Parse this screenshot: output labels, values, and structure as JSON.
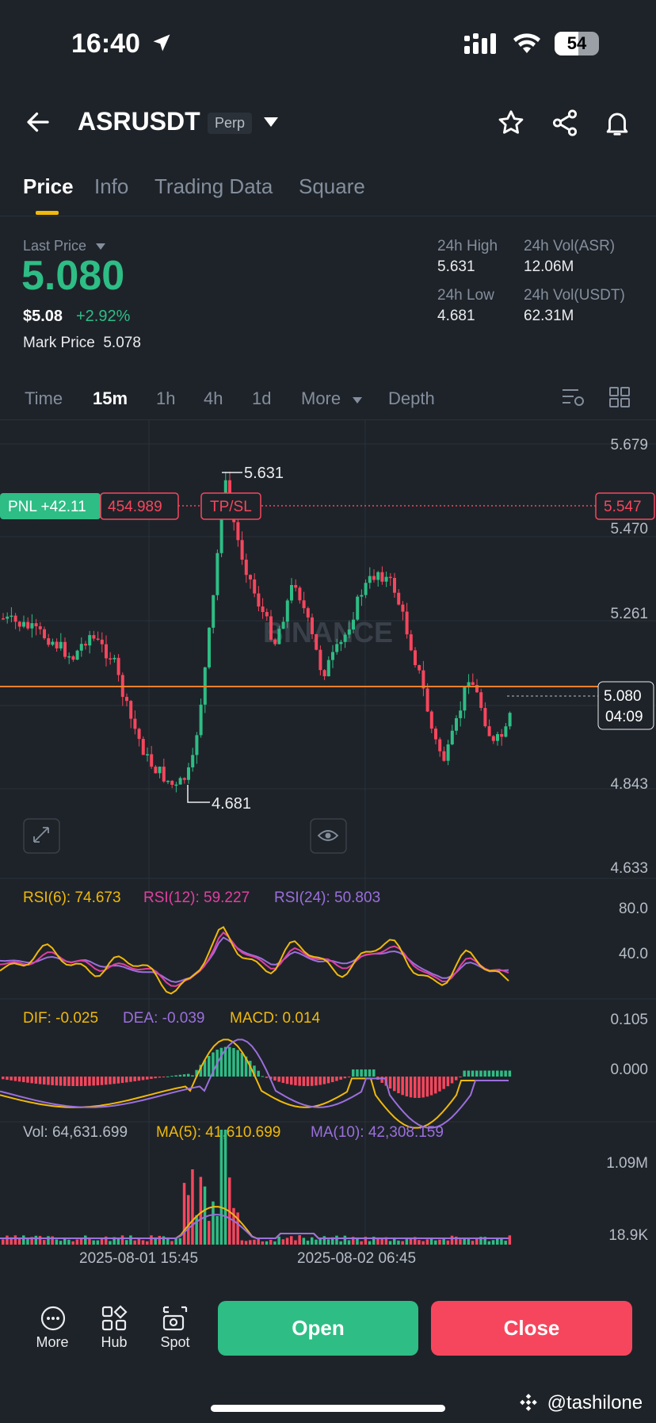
{
  "status": {
    "time": "16:40",
    "battery": "54"
  },
  "header": {
    "symbol": "ASRUSDT",
    "badge": "Perp"
  },
  "tabs": [
    "Price",
    "Info",
    "Trading Data",
    "Square"
  ],
  "price": {
    "last_label": "Last Price",
    "last": "5.080",
    "usd": "$5.08",
    "change": "+2.92%",
    "mark_label": "Mark Price",
    "mark": "5.078"
  },
  "stats": {
    "high_label": "24h High",
    "high": "5.631",
    "low_label": "24h Low",
    "low": "4.681",
    "vol_asr_label": "24h Vol(ASR)",
    "vol_asr": "12.06M",
    "vol_usdt_label": "24h Vol(USDT)",
    "vol_usdt": "62.31M"
  },
  "intervals": {
    "time": "Time",
    "m15": "15m",
    "h1": "1h",
    "h4": "4h",
    "d1": "1d",
    "more": "More",
    "depth": "Depth"
  },
  "chart": {
    "price_axis": [
      "5.679",
      "5.470",
      "5.261",
      "4.843",
      "4.633"
    ],
    "high_label": "5.631",
    "low_label": "4.681",
    "pnl": "PNL +42.11",
    "entry": "454.989",
    "tpsl": "TP/SL",
    "tpsl_price": "5.547",
    "current_price": "5.080",
    "countdown": "04:09",
    "watermark": "BINANCE",
    "rsi6": "RSI(6): 74.673",
    "rsi12": "RSI(12): 59.227",
    "rsi24": "RSI(24): 50.803",
    "rsi_axis": [
      "80.0",
      "40.0"
    ],
    "dif": "DIF: -0.025",
    "dea": "DEA: -0.039",
    "macd": "MACD: 0.014",
    "macd_axis": [
      "0.105",
      "0.000"
    ],
    "vol": "Vol: 64,631.699",
    "ma5": "MA(5): 41,610.699",
    "ma10": "MA(10): 42,308.159",
    "vol_axis": [
      "1.09M",
      "18.9K"
    ],
    "dates": [
      "2025-08-01 15:45",
      "2025-08-02 06:45"
    ]
  },
  "bottom": {
    "more": "More",
    "hub": "Hub",
    "spot": "Spot",
    "open": "Open",
    "close": "Close"
  },
  "credit": "@tashilone",
  "colors": {
    "up": "#2ebd85",
    "down": "#f6465d",
    "accent": "#f0b90b",
    "rsi12": "#e040a0",
    "purple": "#9b6fdd"
  }
}
